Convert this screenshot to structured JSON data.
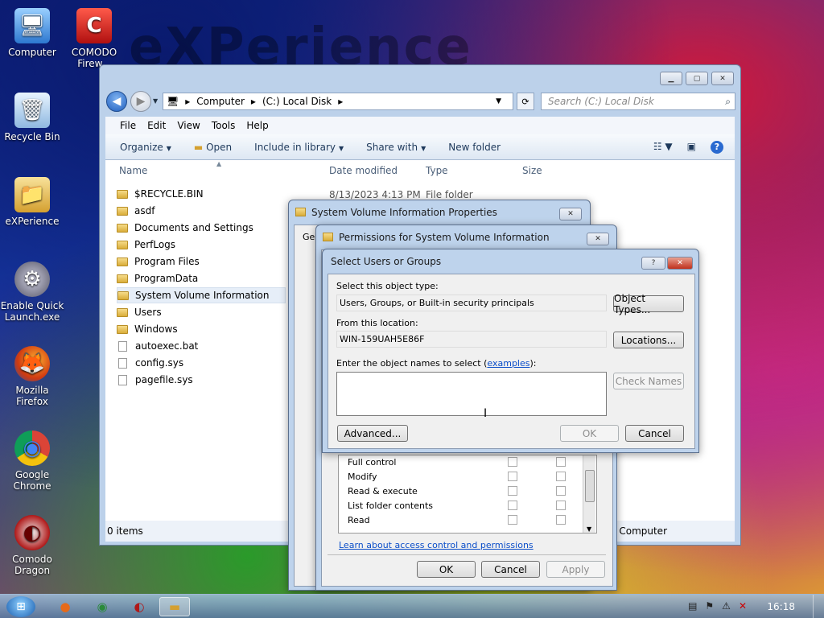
{
  "wallpaper": {
    "logo_text": "eXPerience"
  },
  "desktop_icons": [
    {
      "label": "Computer",
      "glyph": "🖥"
    },
    {
      "label": "COMODO\nFirew...",
      "glyph": "C"
    },
    {
      "label": "Recycle Bin",
      "glyph": "🗑"
    },
    {
      "label": "eXPerience",
      "glyph": "📁"
    },
    {
      "label": "Enable Quick\nLaunch.exe",
      "glyph": "⚙"
    },
    {
      "label": "Mozilla\nFirefox",
      "glyph": "🦊"
    },
    {
      "label": "Google\nChrome",
      "glyph": "◉"
    },
    {
      "label": "Comodo\nDragon",
      "glyph": "◐"
    }
  ],
  "explorer": {
    "address": {
      "segments": [
        "Computer",
        "(C:) Local Disk"
      ]
    },
    "search_placeholder": "Search (C:) Local Disk",
    "menu": [
      "File",
      "Edit",
      "View",
      "Tools",
      "Help"
    ],
    "toolbar": {
      "organize": "Organize",
      "open": "Open",
      "include": "Include in library",
      "share": "Share with",
      "new_folder": "New folder"
    },
    "columns": {
      "name": "Name",
      "date": "Date modified",
      "type": "Type",
      "size": "Size"
    },
    "first_row_date": "8/13/2023 4:13 PM",
    "first_row_type": "File folder",
    "files": [
      {
        "name": "$RECYCLE.BIN",
        "kind": "folder"
      },
      {
        "name": "asdf",
        "kind": "folder"
      },
      {
        "name": "Documents and Settings",
        "kind": "folder-locked"
      },
      {
        "name": "PerfLogs",
        "kind": "folder"
      },
      {
        "name": "Program Files",
        "kind": "folder"
      },
      {
        "name": "ProgramData",
        "kind": "folder"
      },
      {
        "name": "System Volume Information",
        "kind": "folder-locked"
      },
      {
        "name": "Users",
        "kind": "folder"
      },
      {
        "name": "Windows",
        "kind": "folder"
      },
      {
        "name": "autoexec.bat",
        "kind": "file"
      },
      {
        "name": "config.sys",
        "kind": "file"
      },
      {
        "name": "pagefile.sys",
        "kind": "file"
      }
    ],
    "status": {
      "items": "0 items",
      "location": "Computer"
    }
  },
  "properties_dialog": {
    "title": "System Volume Information Properties",
    "tab_partial": "Ge",
    "buttons": {
      "ok": "OK",
      "cancel": "Cancel",
      "apply": "Apply"
    }
  },
  "permissions_dialog": {
    "title": "Permissions for System Volume Information",
    "permissions": [
      "Full control",
      "Modify",
      "Read & execute",
      "List folder contents",
      "Read"
    ],
    "learn_link": "Learn about access control and permissions"
  },
  "select_dialog": {
    "title": "Select Users or Groups",
    "help": "?",
    "object_type_label": "Select this object type:",
    "object_type_value": "Users, Groups, or Built-in security principals",
    "object_types_btn": "Object Types...",
    "location_label": "From this location:",
    "location_value": "WIN-159UAH5E86F",
    "locations_btn": "Locations...",
    "names_label": "Enter the object names to select (",
    "names_link": "examples",
    "names_label_end": "):",
    "check_names_btn": "Check Names",
    "advanced_btn": "Advanced...",
    "ok_btn": "OK",
    "cancel_btn": "Cancel"
  },
  "taskbar": {
    "clock": "16:18"
  }
}
